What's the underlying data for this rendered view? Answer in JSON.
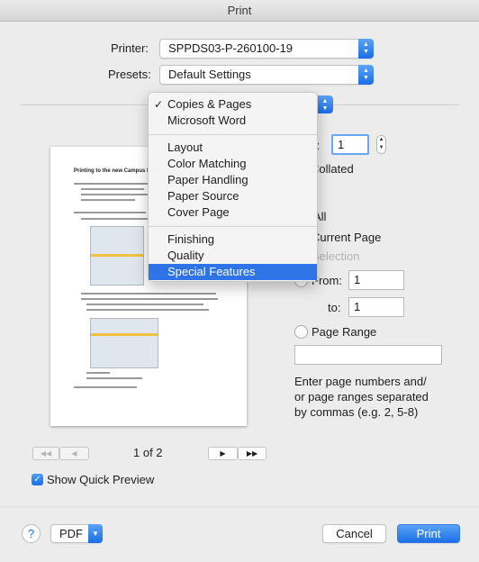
{
  "window": {
    "title": "Print"
  },
  "printer": {
    "label": "Printer:",
    "value": "SPPDS03-P-260100-19"
  },
  "presets": {
    "label": "Presets:",
    "value": "Default Settings"
  },
  "section_menu": {
    "items": [
      {
        "label": "Copies & Pages",
        "checked": true,
        "selected": false
      },
      {
        "label": "Microsoft Word",
        "checked": false,
        "selected": false
      },
      {
        "label": "Layout",
        "checked": false,
        "selected": false
      },
      {
        "label": "Color Matching",
        "checked": false,
        "selected": false
      },
      {
        "label": "Paper Handling",
        "checked": false,
        "selected": false
      },
      {
        "label": "Paper Source",
        "checked": false,
        "selected": false
      },
      {
        "label": "Cover Page",
        "checked": false,
        "selected": false
      },
      {
        "label": "Finishing",
        "checked": false,
        "selected": false
      },
      {
        "label": "Quality",
        "checked": false,
        "selected": false
      },
      {
        "label": "Special Features",
        "checked": false,
        "selected": true
      }
    ],
    "check_glyph": "✓"
  },
  "copies": {
    "label_tail": "s:",
    "value": "1",
    "collated_tail": "Collated"
  },
  "pages": {
    "label_tail": ":",
    "all_tail": "All",
    "current_tail": "Current Page",
    "selection_tail": "Selection",
    "from_tail": "From:",
    "from_value": "1",
    "to_label": "to:",
    "to_value": "1",
    "range_label": "Page Range",
    "range_value": "",
    "help_lines": [
      "Enter page numbers and/",
      "or page ranges separated",
      "by commas (e.g. 2, 5-8)"
    ]
  },
  "preview": {
    "page_title": "Printing to the new Campus Print",
    "page_indicator": "1 of 2",
    "show_quick_preview_label": "Show Quick Preview",
    "show_quick_preview_checked": true
  },
  "footer": {
    "help": "?",
    "pdf_label": "PDF",
    "cancel_label": "Cancel",
    "print_label": "Print"
  },
  "colors": {
    "accent": "#2f74e6"
  }
}
